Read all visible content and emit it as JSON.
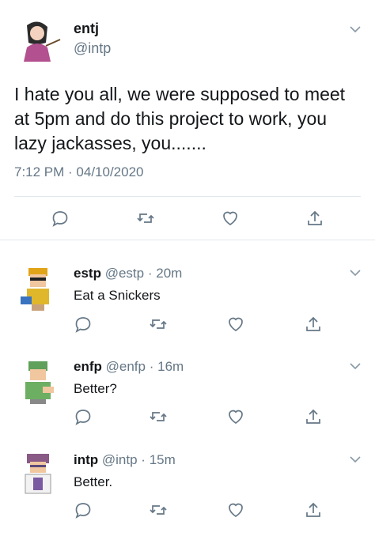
{
  "main_tweet": {
    "name": "entj",
    "handle": "@intp",
    "text": "I hate you all, we were supposed to meet at 5pm and do this project to work, you lazy jackasses, you.......",
    "timestamp": "7:12 PM · 04/10/2020"
  },
  "replies": [
    {
      "name": "estp",
      "handle": "@estp",
      "time": "20m",
      "text": "Eat a Snickers"
    },
    {
      "name": "enfp",
      "handle": "@enfp",
      "time": "16m",
      "text": "Better?"
    },
    {
      "name": "intp",
      "handle": "@intp",
      "time": "15m",
      "text": "Better."
    }
  ],
  "separator": "·",
  "colors": {
    "accent": "#1da1f2",
    "muted": "#657786",
    "text": "#14171a",
    "divider": "#e1e8ed"
  },
  "icons": [
    "chevron-down-icon",
    "reply-icon",
    "retweet-icon",
    "like-icon",
    "share-icon"
  ]
}
